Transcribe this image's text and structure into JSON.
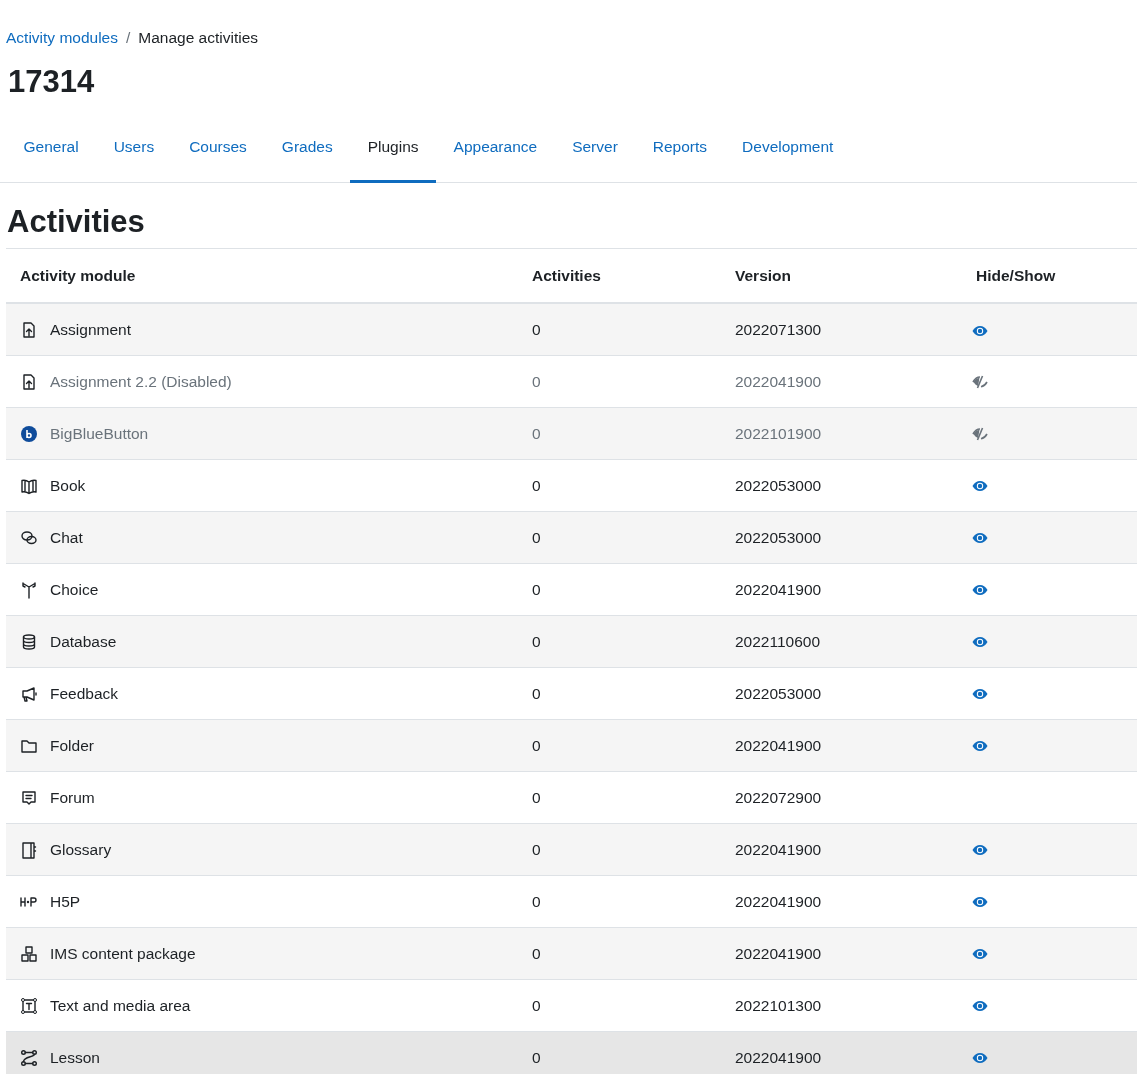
{
  "breadcrumb": [
    {
      "label": "Activity modules",
      "link": true
    },
    {
      "label": "Manage activities",
      "link": false
    }
  ],
  "breadcrumb_separator": "/",
  "page_title": "17314",
  "tabs": [
    {
      "label": "General",
      "selected": false
    },
    {
      "label": "Users",
      "selected": false
    },
    {
      "label": "Courses",
      "selected": false
    },
    {
      "label": "Grades",
      "selected": false
    },
    {
      "label": "Plugins",
      "selected": true
    },
    {
      "label": "Appearance",
      "selected": false
    },
    {
      "label": "Server",
      "selected": false
    },
    {
      "label": "Reports",
      "selected": false
    },
    {
      "label": "Development",
      "selected": false
    }
  ],
  "heading": "Activities",
  "table": {
    "columns": [
      "Activity module",
      "Activities",
      "Version",
      "Hide/Show"
    ],
    "rows": [
      {
        "kind": "assign",
        "name": "Assignment",
        "activities": "0",
        "version": "2022071300",
        "disabled": false,
        "has_toggle": true,
        "visible": true,
        "hovered": false
      },
      {
        "kind": "assign",
        "name": "Assignment 2.2 (Disabled)",
        "activities": "0",
        "version": "2022041900",
        "disabled": true,
        "has_toggle": true,
        "visible": false,
        "hovered": false
      },
      {
        "kind": "bbb",
        "name": "BigBlueButton",
        "activities": "0",
        "version": "2022101900",
        "disabled": true,
        "has_toggle": true,
        "visible": false,
        "hovered": false
      },
      {
        "kind": "book",
        "name": "Book",
        "activities": "0",
        "version": "2022053000",
        "disabled": false,
        "has_toggle": true,
        "visible": true,
        "hovered": false
      },
      {
        "kind": "chat",
        "name": "Chat",
        "activities": "0",
        "version": "2022053000",
        "disabled": false,
        "has_toggle": true,
        "visible": true,
        "hovered": false
      },
      {
        "kind": "choice",
        "name": "Choice",
        "activities": "0",
        "version": "2022041900",
        "disabled": false,
        "has_toggle": true,
        "visible": true,
        "hovered": false
      },
      {
        "kind": "database",
        "name": "Database",
        "activities": "0",
        "version": "2022110600",
        "disabled": false,
        "has_toggle": true,
        "visible": true,
        "hovered": false
      },
      {
        "kind": "feedback",
        "name": "Feedback",
        "activities": "0",
        "version": "2022053000",
        "disabled": false,
        "has_toggle": true,
        "visible": true,
        "hovered": false
      },
      {
        "kind": "folder",
        "name": "Folder",
        "activities": "0",
        "version": "2022041900",
        "disabled": false,
        "has_toggle": true,
        "visible": true,
        "hovered": false
      },
      {
        "kind": "forum",
        "name": "Forum",
        "activities": "0",
        "version": "2022072900",
        "disabled": false,
        "has_toggle": false,
        "hovered": false
      },
      {
        "kind": "glossary",
        "name": "Glossary",
        "activities": "0",
        "version": "2022041900",
        "disabled": false,
        "has_toggle": true,
        "visible": true,
        "hovered": false
      },
      {
        "kind": "h5p",
        "name": "H5P",
        "activities": "0",
        "version": "2022041900",
        "disabled": false,
        "has_toggle": true,
        "visible": true,
        "hovered": false
      },
      {
        "kind": "ims",
        "name": "IMS content package",
        "activities": "0",
        "version": "2022041900",
        "disabled": false,
        "has_toggle": true,
        "visible": true,
        "hovered": false
      },
      {
        "kind": "textmedia",
        "name": "Text and media area",
        "activities": "0",
        "version": "2022101300",
        "disabled": false,
        "has_toggle": true,
        "visible": true,
        "hovered": false
      },
      {
        "kind": "lesson",
        "name": "Lesson",
        "activities": "0",
        "version": "2022041900",
        "disabled": false,
        "has_toggle": true,
        "visible": true,
        "hovered": true
      }
    ]
  }
}
